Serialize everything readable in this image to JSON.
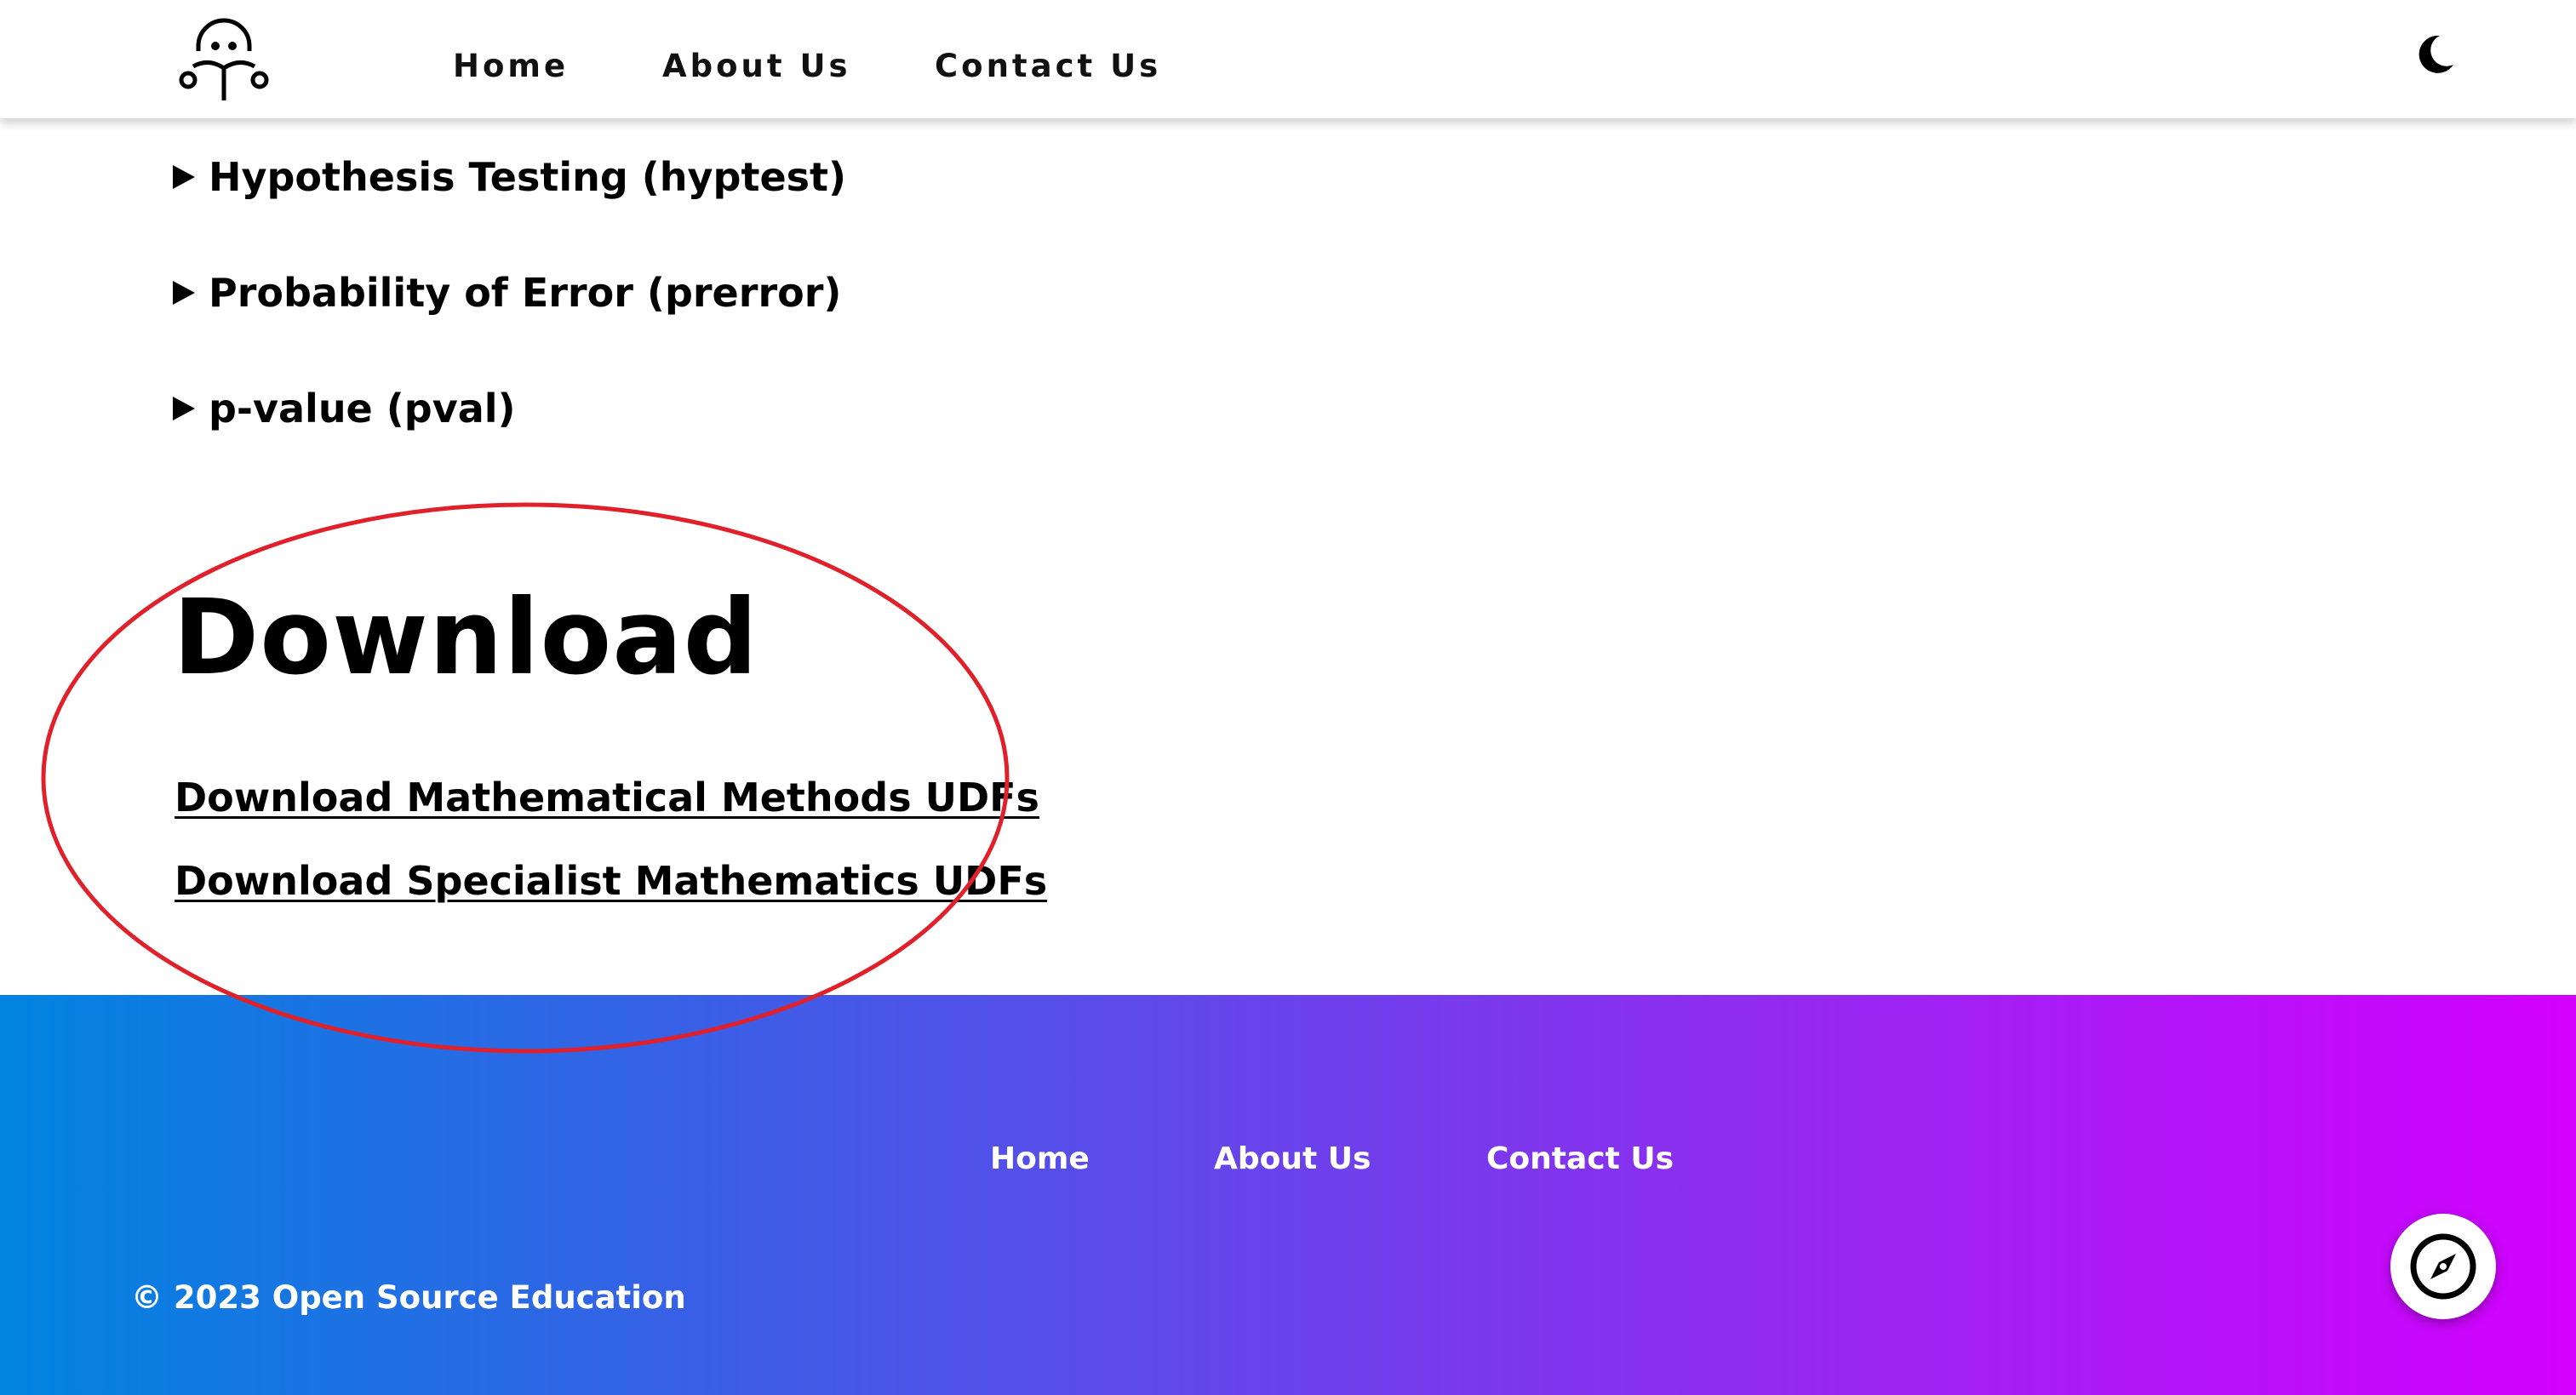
{
  "header": {
    "logo_icon": "reader-person-logo-icon",
    "nav": {
      "home": "Home",
      "about": "About Us",
      "contact": "Contact Us"
    },
    "theme_toggle_icon": "moon-icon"
  },
  "main": {
    "accordion": [
      {
        "label": "Hypothesis Testing (hyptest)",
        "icon": "triangle-right-icon"
      },
      {
        "label": "Probability of Error (prerror)",
        "icon": "triangle-right-icon"
      },
      {
        "label": "p-value (pval)",
        "icon": "triangle-right-icon"
      }
    ],
    "download_section": {
      "title": "Download",
      "links": [
        "Download Mathematical Methods UDFs",
        "Download Specialist Mathematics UDFs"
      ]
    },
    "annotation_color": "#e0202a"
  },
  "footer": {
    "nav": {
      "home": "Home",
      "about": "About Us",
      "contact": "Contact Us"
    },
    "copyright": "© 2023 Open Source Education",
    "gradient_colors": [
      "#0084e0",
      "#4a55e8",
      "#8a2fee",
      "#d400ff"
    ],
    "floating_button_icon": "compass-icon"
  }
}
